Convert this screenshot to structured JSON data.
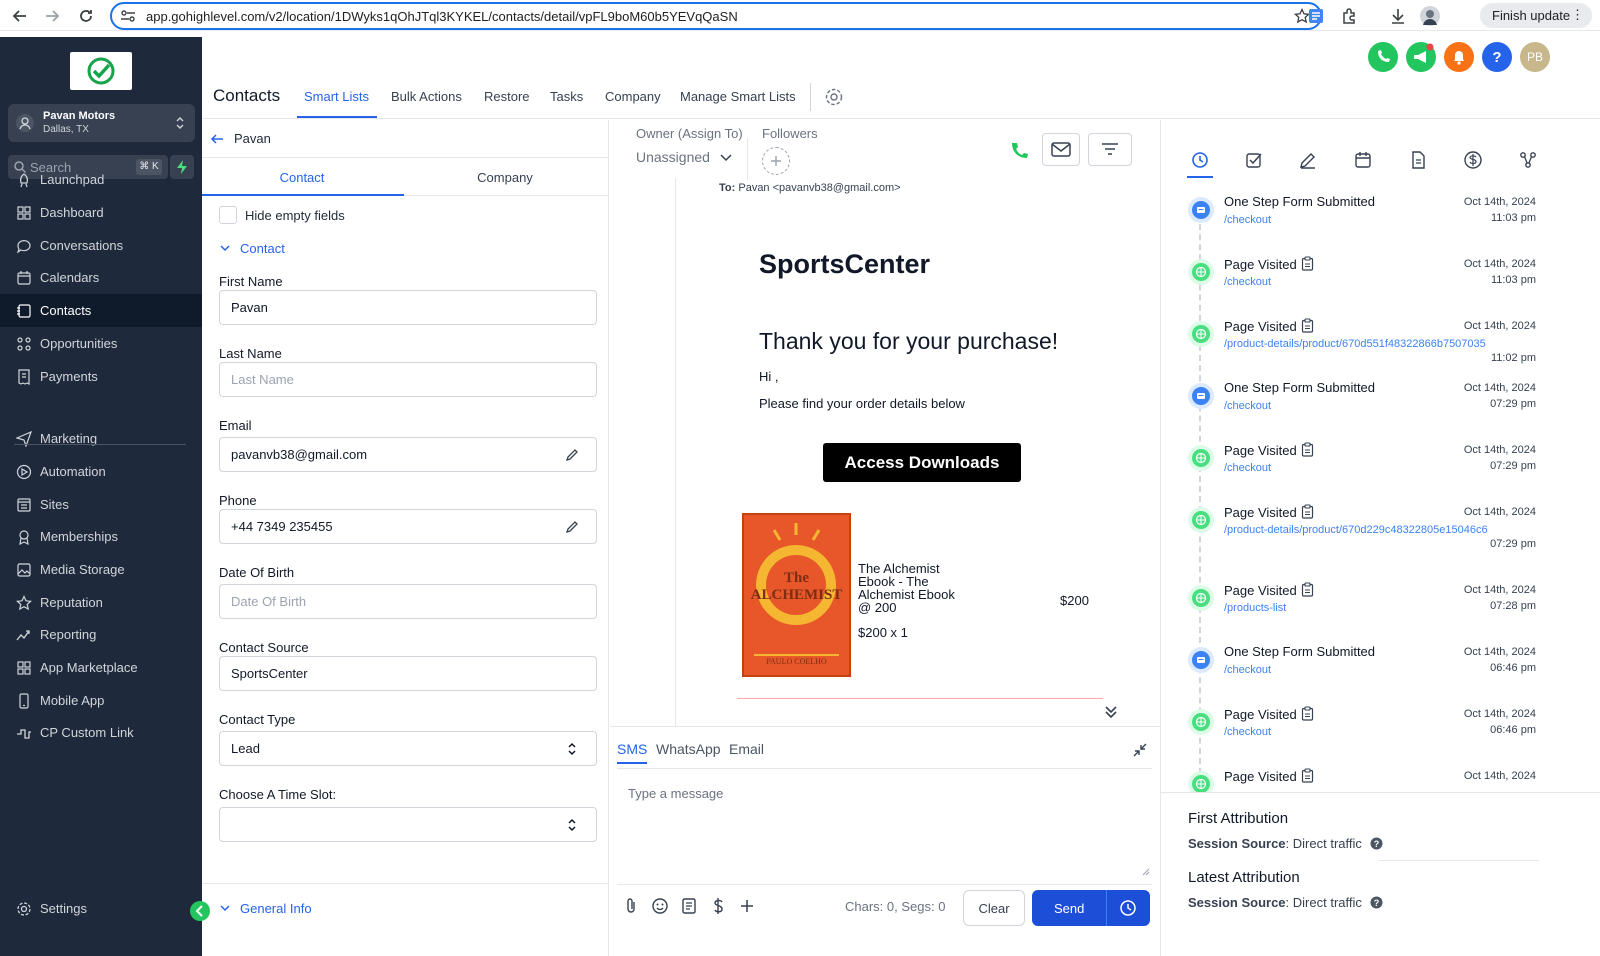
{
  "browser": {
    "url": "app.gohighlevel.com/v2/location/1DWyks1qOhJTql3KYKEL/contacts/detail/vpFL9boM60b5YEVqQaSN",
    "finish_update": "Finish update"
  },
  "sidebar": {
    "location_name": "Pavan Motors",
    "location_city": "Dallas, TX",
    "search_placeholder": "Search",
    "search_shortcut": "⌘ K",
    "items": [
      {
        "label": "Launchpad",
        "icon": "rocket-icon"
      },
      {
        "label": "Dashboard",
        "icon": "grid-icon"
      },
      {
        "label": "Conversations",
        "icon": "chat-icon"
      },
      {
        "label": "Calendars",
        "icon": "calendar-icon"
      },
      {
        "label": "Contacts",
        "icon": "contacts-icon"
      },
      {
        "label": "Opportunities",
        "icon": "funnel-icon"
      },
      {
        "label": "Payments",
        "icon": "receipt-icon"
      },
      {
        "label": "Marketing",
        "icon": "send-icon"
      },
      {
        "label": "Automation",
        "icon": "automation-icon"
      },
      {
        "label": "Sites",
        "icon": "sites-icon"
      },
      {
        "label": "Memberships",
        "icon": "membership-icon"
      },
      {
        "label": "Media Storage",
        "icon": "image-icon"
      },
      {
        "label": "Reputation",
        "icon": "star-icon"
      },
      {
        "label": "Reporting",
        "icon": "chart-icon"
      },
      {
        "label": "App Marketplace",
        "icon": "apps-icon"
      },
      {
        "label": "Mobile App",
        "icon": "phone-icon"
      },
      {
        "label": "CP Custom Link",
        "icon": "link-icon"
      }
    ],
    "settings": "Settings",
    "active": "Contacts"
  },
  "header": {
    "title": "Contacts",
    "tabs": [
      "Smart Lists",
      "Bulk Actions",
      "Restore",
      "Tasks",
      "Company",
      "Manage Smart Lists"
    ],
    "user_initials": "PB"
  },
  "contact": {
    "back_name": "Pavan",
    "tabs": [
      "Contact",
      "Company"
    ],
    "hide_empty": "Hide empty fields",
    "section": "Contact",
    "fields": {
      "first_name_label": "First Name",
      "first_name": "Pavan",
      "last_name_label": "Last Name",
      "last_name_placeholder": "Last Name",
      "email_label": "Email",
      "email": "pavanvb38@gmail.com",
      "phone_label": "Phone",
      "phone": "+44 7349 235455",
      "dob_label": "Date Of Birth",
      "dob_placeholder": "Date Of Birth",
      "source_label": "Contact Source",
      "source": "SportsCenter",
      "type_label": "Contact Type",
      "type": "Lead",
      "timeslot_label": "Choose A Time Slot:"
    },
    "general_info": "General Info"
  },
  "conversation": {
    "owner_label": "Owner (Assign To)",
    "owner_value": "Unassigned",
    "followers_label": "Followers",
    "email": {
      "to_label": "To:",
      "to_value": "Pavan <pavanvb38@gmail.com>",
      "brand": "SportsCenter",
      "heading": "Thank you for your purchase!",
      "greeting": "Hi ,",
      "intro": "Please find your order details below",
      "button": "Access Downloads",
      "book_cover_title": "The ALCHEMIST",
      "book_cover_author": "PAULO COELHO",
      "product_name": "The Alchemist Ebook - The Alchemist Ebook @ 200",
      "product_qty": "$200 x 1",
      "product_price": "$200"
    },
    "channels": [
      "SMS",
      "WhatsApp",
      "Email"
    ],
    "message_placeholder": "Type a message",
    "chars": "Chars: 0, Segs: 0",
    "clear": "Clear",
    "send": "Send"
  },
  "activity": {
    "items": [
      {
        "title": "One Step Form Submitted",
        "link": "/checkout",
        "date": "Oct 14th, 2024",
        "time": "11:03 pm",
        "kind": "form"
      },
      {
        "title": "Page Visited",
        "link": "/checkout",
        "date": "Oct 14th, 2024",
        "time": "11:03 pm",
        "kind": "page"
      },
      {
        "title": "Page Visited",
        "link": "/product-details/product/670d551f48322866b7507035",
        "date": "Oct 14th, 2024",
        "time": "11:02 pm",
        "kind": "page"
      },
      {
        "title": "One Step Form Submitted",
        "link": "/checkout",
        "date": "Oct 14th, 2024",
        "time": "07:29 pm",
        "kind": "form"
      },
      {
        "title": "Page Visited",
        "link": "/checkout",
        "date": "Oct 14th, 2024",
        "time": "07:29 pm",
        "kind": "page"
      },
      {
        "title": "Page Visited",
        "link": "/product-details/product/670d229c48322805e15046c6",
        "date": "Oct 14th, 2024",
        "time": "07:29 pm",
        "kind": "page"
      },
      {
        "title": "Page Visited",
        "link": "/products-list",
        "date": "Oct 14th, 2024",
        "time": "07:28 pm",
        "kind": "page"
      },
      {
        "title": "One Step Form Submitted",
        "link": "/checkout",
        "date": "Oct 14th, 2024",
        "time": "06:46 pm",
        "kind": "form"
      },
      {
        "title": "Page Visited",
        "link": "/checkout",
        "date": "Oct 14th, 2024",
        "time": "06:46 pm",
        "kind": "page"
      },
      {
        "title": "Page Visited",
        "link": "",
        "date": "Oct 14th, 2024",
        "time": "",
        "kind": "page"
      }
    ],
    "first_attribution": "First Attribution",
    "latest_attribution": "Latest Attribution",
    "session_source_label": "Session Source",
    "session_source_value": ": Direct traffic"
  },
  "colors": {
    "sidebar": "#1e2a3b",
    "accent": "#2563eb",
    "green": "#4ade80",
    "form_blue": "#3b82f6"
  }
}
